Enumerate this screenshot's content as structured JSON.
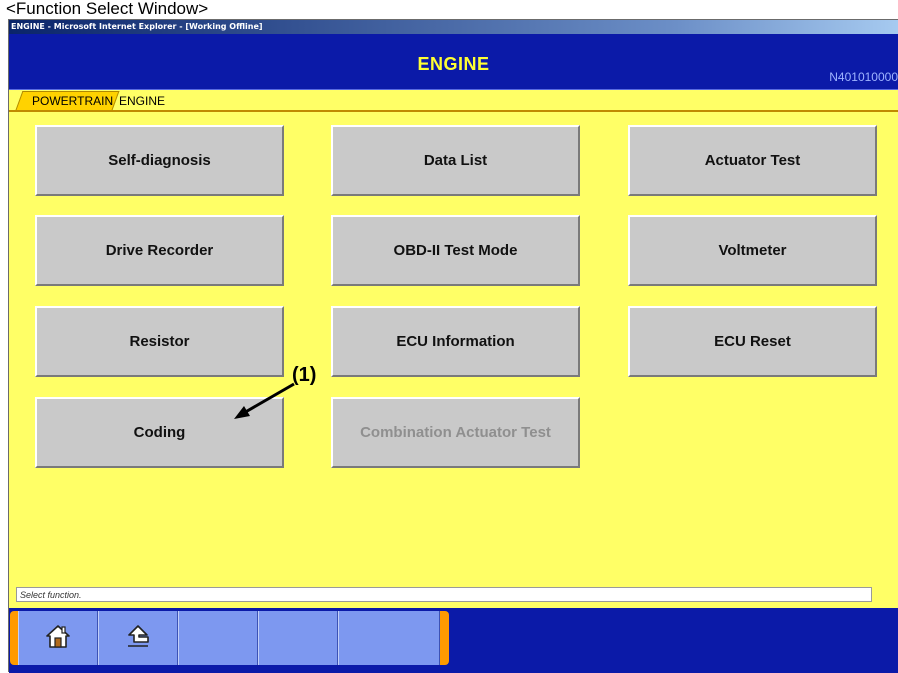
{
  "caption": "<Function Select Window>",
  "window_title": "ENGINE - Microsoft Internet Explorer - [Working Offline]",
  "header": {
    "title": "ENGINE",
    "code": "N401010000"
  },
  "breadcrumb": [
    "POWERTRAIN",
    "ENGINE"
  ],
  "functions": {
    "self_diagnosis": "Self-diagnosis",
    "data_list": "Data List",
    "actuator_test": "Actuator Test",
    "drive_recorder": "Drive Recorder",
    "obd_test_mode": "OBD-II Test Mode",
    "voltmeter": "Voltmeter",
    "resistor": "Resistor",
    "ecu_information": "ECU Information",
    "ecu_reset": "ECU Reset",
    "coding": "Coding",
    "combination_actuator_test": "Combination Actuator Test"
  },
  "annotation": "(1)",
  "status_text": "Select function.",
  "toolbar": {
    "icons": [
      "home-icon",
      "up-arrow-icon"
    ]
  },
  "colors": {
    "background": "#ffff66",
    "header": "#0b1aa8",
    "header_title": "#ffff33",
    "button": "#c9c9c9",
    "toolbar_accent": "#ff9a00"
  }
}
